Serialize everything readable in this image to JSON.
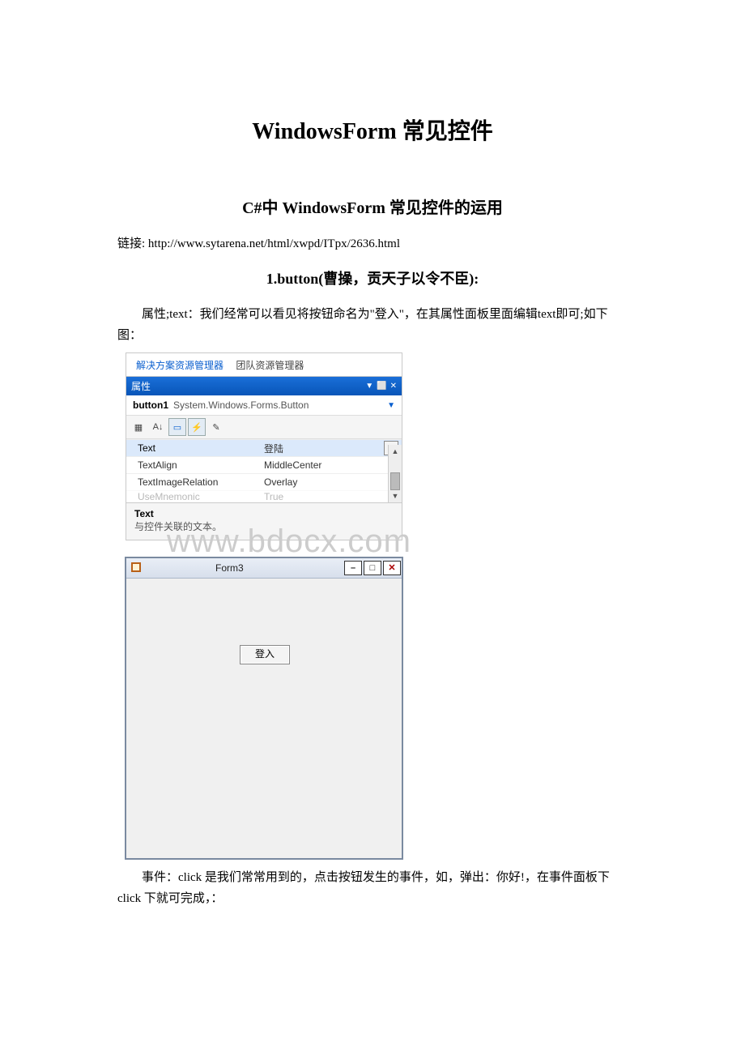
{
  "doc": {
    "title": "WindowsForm 常见控件",
    "subtitle": "C#中 WindowsForm 常见控件的运用",
    "link_line": "链接: http://www.sytarena.net/html/xwpd/ITpx/2636.html",
    "section1_heading": "1.button(曹操，贡天子以令不臣):",
    "para1": "属性;text：我们经常可以看见将按钮命名为\"登入\"，在其属性面板里面编辑text即可;如下图：",
    "para2": "事件：click 是我们常常用到的，点击按钮发生的事件，如，弹出：你好!，在事件面板下 click 下就可完成，：",
    "watermark": "www.bdocx.com"
  },
  "panel": {
    "tab_active": "解决方案资源管理器",
    "tab_inactive": "团队资源管理器",
    "header": "属性",
    "object_name": "button1",
    "object_type": "System.Windows.Forms.Button",
    "rows": [
      {
        "name": "Text",
        "value": "登陆",
        "selected": true,
        "combo": true
      },
      {
        "name": "TextAlign",
        "value": "MiddleCenter"
      },
      {
        "name": "TextImageRelation",
        "value": "Overlay"
      },
      {
        "name": "UseMnemonic",
        "value": "True",
        "faded": true
      }
    ],
    "desc_title": "Text",
    "desc_body": "与控件关联的文本。"
  },
  "form": {
    "title": "Form3",
    "button_label": "登入"
  }
}
